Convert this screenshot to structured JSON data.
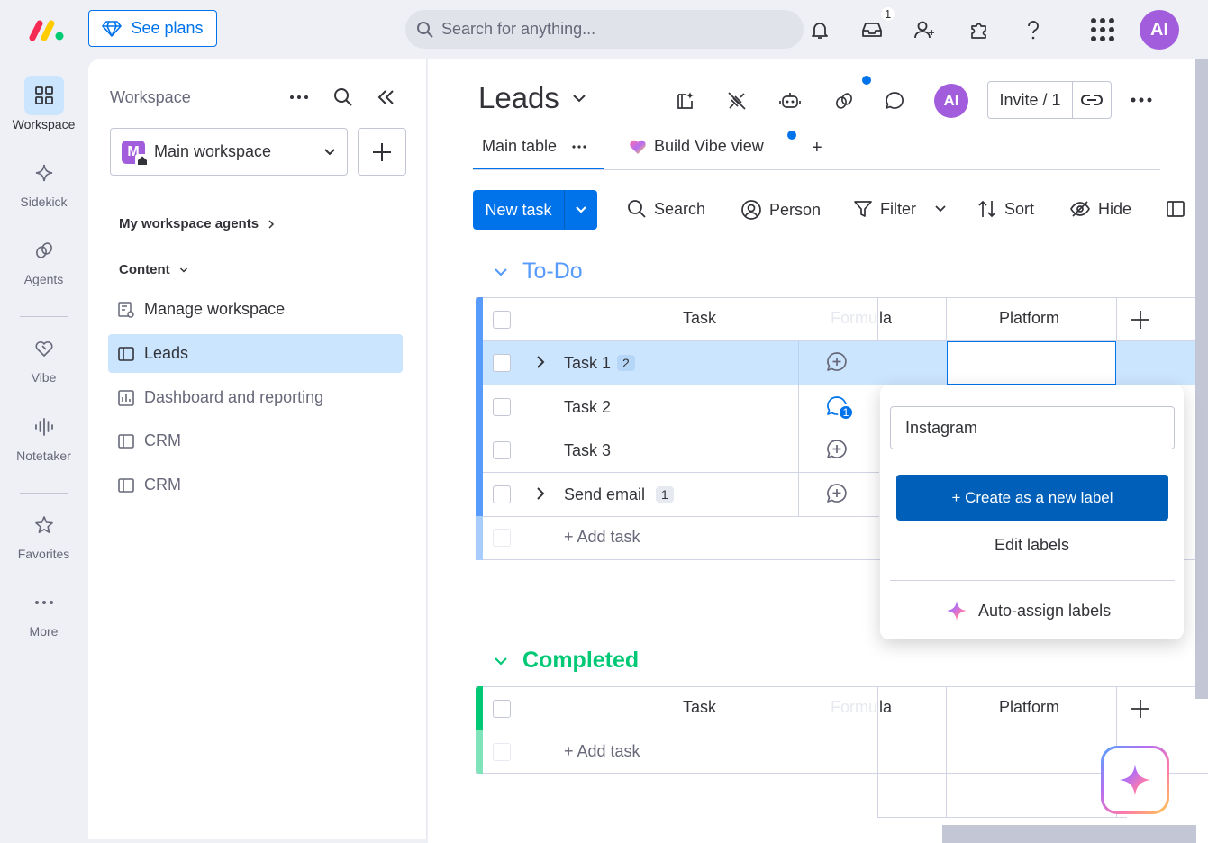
{
  "topbar": {
    "see_plans": "See plans",
    "search_placeholder": "Search for anything...",
    "inbox_count": "1",
    "avatar": "AI"
  },
  "rail": {
    "items": [
      {
        "label": "Workspace",
        "icon": "grid-icon"
      },
      {
        "label": "Sidekick",
        "icon": "sparkle-icon"
      },
      {
        "label": "Agents",
        "icon": "agents-icon"
      },
      {
        "label": "Vibe",
        "icon": "heart-icon"
      },
      {
        "label": "Notetaker",
        "icon": "audio-icon"
      },
      {
        "label": "Favorites",
        "icon": "star-icon"
      },
      {
        "label": "More",
        "icon": "more-icon"
      }
    ]
  },
  "workspace": {
    "header": "Workspace",
    "selected": "Main workspace",
    "selected_initial": "M",
    "agents_link": "My workspace agents",
    "content_label": "Content",
    "items": [
      {
        "label": "Manage workspace"
      },
      {
        "label": "Leads"
      },
      {
        "label": "Dashboard and reporting"
      },
      {
        "label": "CRM"
      },
      {
        "label": "CRM"
      }
    ]
  },
  "board": {
    "title": "Leads",
    "avatar": "AI",
    "invite": "Invite / 1",
    "tabs": [
      {
        "label": "Main table"
      },
      {
        "label": "Build Vibe view"
      },
      {
        "label": "+"
      }
    ],
    "toolbar": {
      "new_task": "New task",
      "search": "Search",
      "person": "Person",
      "filter": "Filter",
      "sort": "Sort",
      "hide": "Hide"
    },
    "groups": [
      {
        "title": "To-Do",
        "color": "#579bfc",
        "col_task": "Task",
        "col_formula_a": "Formu",
        "col_formula_b": "la",
        "col_platform": "Platform",
        "rows": [
          {
            "name": "Task 1",
            "count": "2"
          },
          {
            "name": "Task 2",
            "count": "",
            "updates": "1"
          },
          {
            "name": "Task 3",
            "count": ""
          },
          {
            "name": "Send email",
            "count": "1"
          }
        ],
        "add": "+ Add task"
      },
      {
        "title": "Completed",
        "color": "#00c875",
        "col_task": "Task",
        "col_formula_a": "Formu",
        "col_formula_b": "la",
        "col_platform": "Platform",
        "add": "+ Add task"
      }
    ]
  },
  "dropdown": {
    "input_value": "Instagram",
    "create": "+ Create as a new label",
    "edit": "Edit labels",
    "auto_assign": "Auto-assign labels"
  },
  "colors": {
    "primary": "#0073ea",
    "todo": "#579bfc",
    "completed": "#00c875",
    "avatar": "#a25ddc"
  }
}
